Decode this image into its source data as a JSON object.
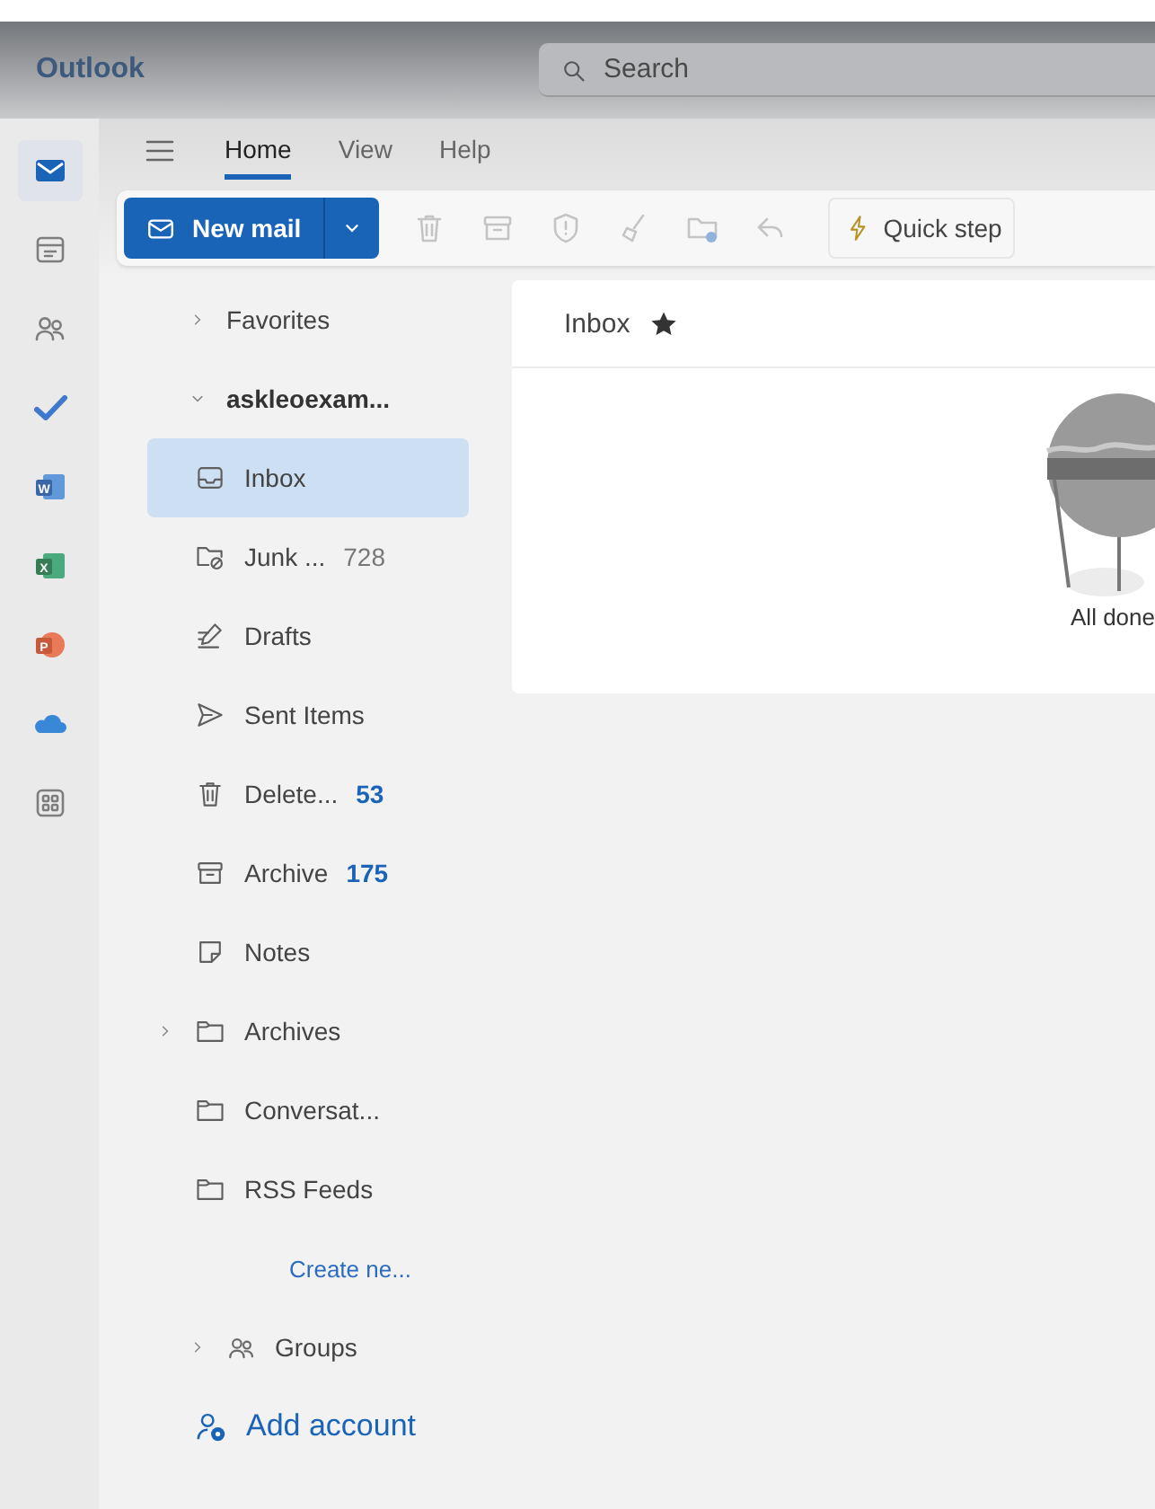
{
  "header": {
    "app_title": "Outlook",
    "search": {
      "placeholder": "Search"
    }
  },
  "rail": [
    {
      "kind": "mail",
      "selected": true
    },
    {
      "kind": "calendar",
      "selected": false
    },
    {
      "kind": "people",
      "selected": false
    },
    {
      "kind": "todo",
      "selected": false
    },
    {
      "kind": "word",
      "letter": "W",
      "selected": false
    },
    {
      "kind": "excel",
      "letter": "X",
      "selected": false
    },
    {
      "kind": "powerpoint",
      "letter": "P",
      "selected": false
    },
    {
      "kind": "onedrive",
      "selected": false
    },
    {
      "kind": "apps",
      "selected": false
    }
  ],
  "ribbon_tabs": [
    {
      "label": "Home",
      "selected": true
    },
    {
      "label": "View",
      "selected": false
    },
    {
      "label": "Help",
      "selected": false
    }
  ],
  "toolbar": {
    "new_mail": {
      "label": "New mail"
    },
    "tools": [
      {
        "kind": "delete"
      },
      {
        "kind": "archive"
      },
      {
        "kind": "report"
      },
      {
        "kind": "sweep"
      },
      {
        "kind": "move"
      },
      {
        "kind": "reply"
      }
    ],
    "quick_steps": {
      "label": "Quick step"
    }
  },
  "folder_pane": {
    "favorites": {
      "label": "Favorites",
      "expanded": false
    },
    "account": {
      "label": "askleoexam...",
      "expanded": true,
      "children": [
        {
          "kind": "inbox",
          "label": "Inbox",
          "selected": true
        },
        {
          "kind": "junk",
          "label": "Junk ...",
          "count": "728",
          "unread": false,
          "selected": false
        },
        {
          "kind": "drafts",
          "label": "Drafts",
          "selected": false
        },
        {
          "kind": "sent",
          "label": "Sent Items",
          "selected": false
        },
        {
          "kind": "deleted",
          "label": "Delete...",
          "count": "53",
          "unread": true,
          "selected": false
        },
        {
          "kind": "archive",
          "label": "Archive",
          "count": "175",
          "unread": true,
          "selected": false
        },
        {
          "kind": "notes",
          "label": "Notes",
          "selected": false
        },
        {
          "kind": "folder",
          "label": "Archives",
          "expanded": false,
          "selected": false
        },
        {
          "kind": "folder",
          "label": "Conversat...",
          "selected": false
        },
        {
          "kind": "folder",
          "label": "RSS Feeds",
          "selected": false
        },
        {
          "kind": "link",
          "label": "Create ne..."
        }
      ]
    },
    "groups": {
      "label": "Groups",
      "expanded": false
    },
    "add_account": {
      "label": "Add account"
    }
  },
  "message_list": {
    "title": "Inbox",
    "favorite": true,
    "empty_state": "All done"
  }
}
